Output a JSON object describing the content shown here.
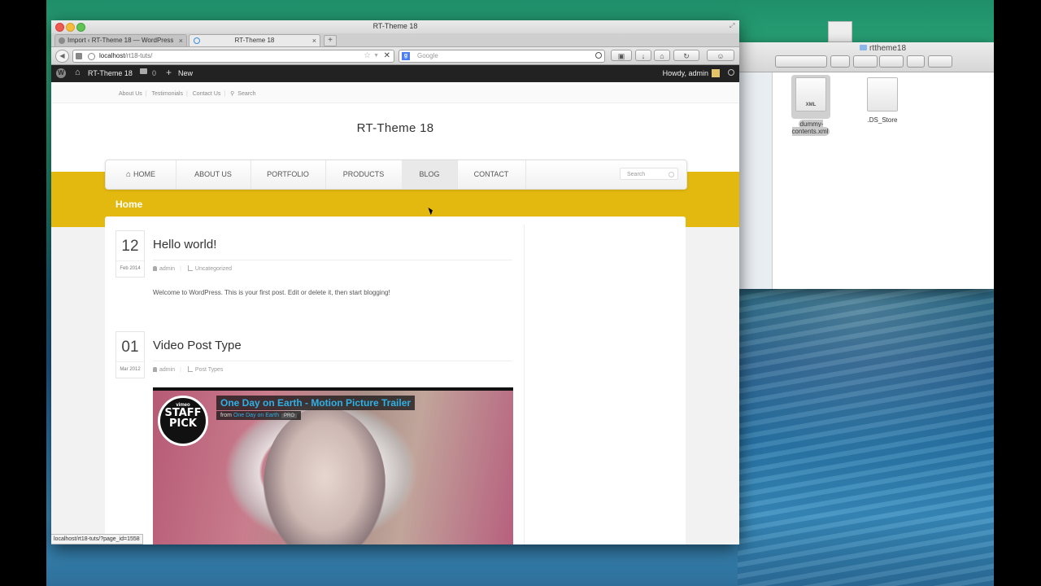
{
  "browser": {
    "window_title": "RT-Theme 18",
    "tabs": [
      {
        "label": "Import ‹ RT-Theme 18 — WordPress",
        "close": "×"
      },
      {
        "label": "RT-Theme 18",
        "close": "×"
      }
    ],
    "new_tab": "+",
    "url_host": "localhost",
    "url_path": "/rt18-tuts/",
    "search_placeholder": "Google",
    "status_url": "localhost/rt18-tuts/?page_id=1558"
  },
  "wp_admin_bar": {
    "site_name": "RT-Theme 18",
    "comment_count": "0",
    "new_label": "New",
    "howdy": "Howdy, admin"
  },
  "site": {
    "top_links": [
      "About Us",
      "Testimonials",
      "Contact Us",
      "Search"
    ],
    "title": "RT-Theme 18",
    "nav": [
      "HOME",
      "ABOUT US",
      "PORTFOLIO",
      "PRODUCTS",
      "BLOG",
      "CONTACT"
    ],
    "nav_active": "BLOG",
    "nav_search_placeholder": "Search",
    "page_heading": "Home",
    "accent_color": "#e3b90f"
  },
  "posts": [
    {
      "day": "12",
      "month_year": "Feb 2014",
      "title": "Hello world!",
      "author": "admin",
      "category": "Uncategorized",
      "excerpt": "Welcome to WordPress. This is your first post. Edit or delete it, then start blogging!"
    },
    {
      "day": "01",
      "month_year": "Mar 2012",
      "title": "Video Post Type",
      "author": "admin",
      "category": "Post Types",
      "video": {
        "badge_top": "vimeo",
        "badge_main": "STAFF PICK",
        "title": "One Day on Earth - Motion Picture Trailer",
        "from_label": "from",
        "channel": "One Day on Earth",
        "pro": "PRO"
      }
    }
  ],
  "finder": {
    "title": "rttheme18",
    "files": [
      {
        "name": "dummy-contents.xml",
        "badge": "XML",
        "selected": true
      },
      {
        "name": ".DS_Store",
        "badge": "",
        "selected": false
      }
    ]
  }
}
